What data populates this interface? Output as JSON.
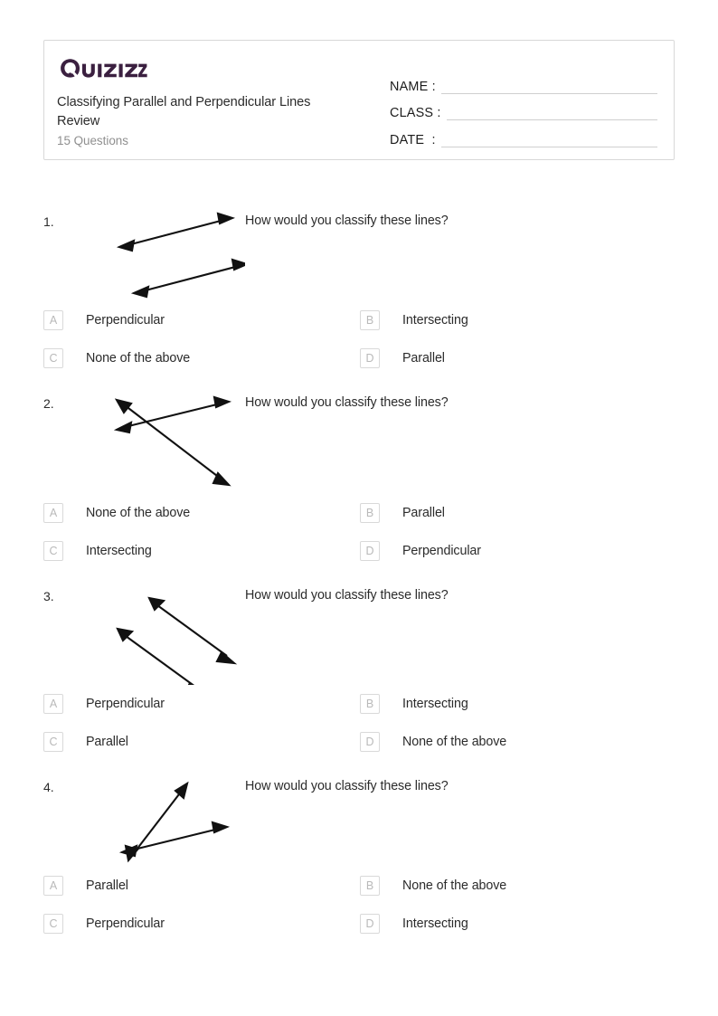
{
  "brand": {
    "logo_text": "Quizizz",
    "logo_color": "#3b2040"
  },
  "header": {
    "title": "Classifying Parallel and Perpendicular Lines Review",
    "question_count": "15 Questions",
    "fields": [
      {
        "label": "NAME :"
      },
      {
        "label": "CLASS :"
      },
      {
        "label": "DATE  :"
      }
    ]
  },
  "questions": [
    {
      "number": "1.",
      "prompt": "How would you classify these lines?",
      "figure": "two-parallel-lines-up-right",
      "options": [
        {
          "letter": "A",
          "text": "Perpendicular"
        },
        {
          "letter": "B",
          "text": "Intersecting"
        },
        {
          "letter": "C",
          "text": "None of the above"
        },
        {
          "letter": "D",
          "text": "Parallel"
        }
      ]
    },
    {
      "number": "2.",
      "prompt": "How would you classify these lines?",
      "figure": "two-intersecting-lines-x",
      "options": [
        {
          "letter": "A",
          "text": "None of the above"
        },
        {
          "letter": "B",
          "text": "Parallel"
        },
        {
          "letter": "C",
          "text": "Intersecting"
        },
        {
          "letter": "D",
          "text": "Perpendicular"
        }
      ]
    },
    {
      "number": "3.",
      "prompt": "How would you classify these lines?",
      "figure": "two-parallel-lines-down-right",
      "options": [
        {
          "letter": "A",
          "text": "Perpendicular"
        },
        {
          "letter": "B",
          "text": "Intersecting"
        },
        {
          "letter": "C",
          "text": "Parallel"
        },
        {
          "letter": "D",
          "text": "None of the above"
        }
      ]
    },
    {
      "number": "4.",
      "prompt": "How would you classify these lines?",
      "figure": "two-intersecting-lines-shallow",
      "options": [
        {
          "letter": "A",
          "text": "Parallel"
        },
        {
          "letter": "B",
          "text": "None of the above"
        },
        {
          "letter": "C",
          "text": "Perpendicular"
        },
        {
          "letter": "D",
          "text": "Intersecting"
        }
      ]
    }
  ]
}
